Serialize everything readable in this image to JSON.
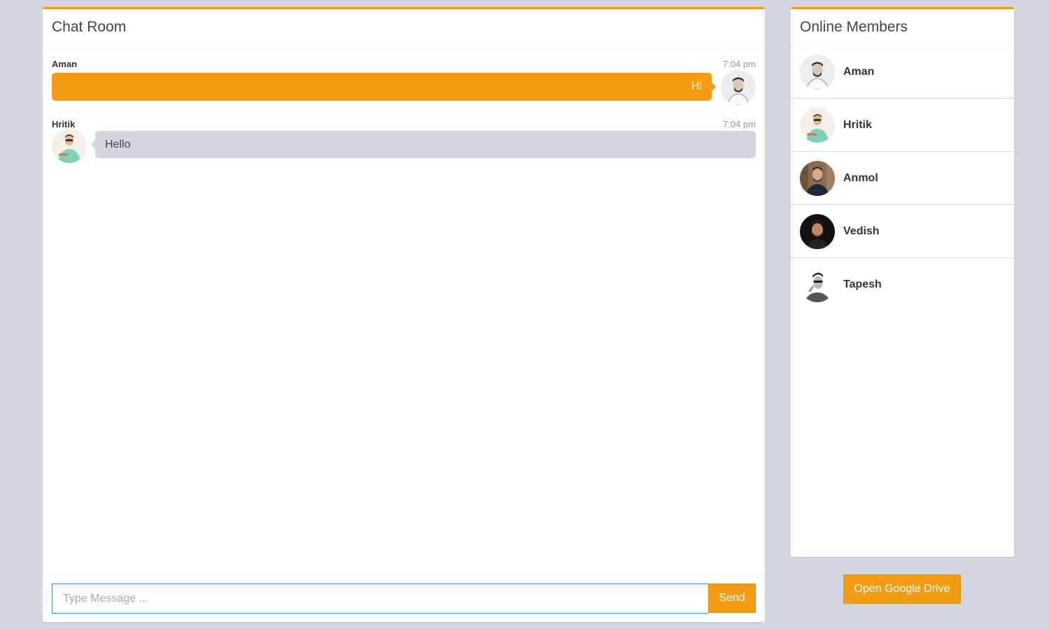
{
  "chat": {
    "title": "Chat Room",
    "messages": [
      {
        "name": "Aman",
        "time": "7:04 pm",
        "text": "Hi",
        "side": "right"
      },
      {
        "name": "Hritik",
        "time": "7:04 pm",
        "text": "Hello",
        "side": "left"
      }
    ],
    "input_placeholder": "Type Message ...",
    "send_label": "Send"
  },
  "members": {
    "title": "Online Members",
    "list": [
      {
        "name": "Aman"
      },
      {
        "name": "Hritik"
      },
      {
        "name": "Anmol"
      },
      {
        "name": "Vedish"
      },
      {
        "name": "Tapesh"
      }
    ]
  },
  "drive_button_label": "Open Google Drive",
  "colors": {
    "accent": "#f39c12",
    "background": "#d2d6de",
    "input_border": "#3c8dbc"
  }
}
